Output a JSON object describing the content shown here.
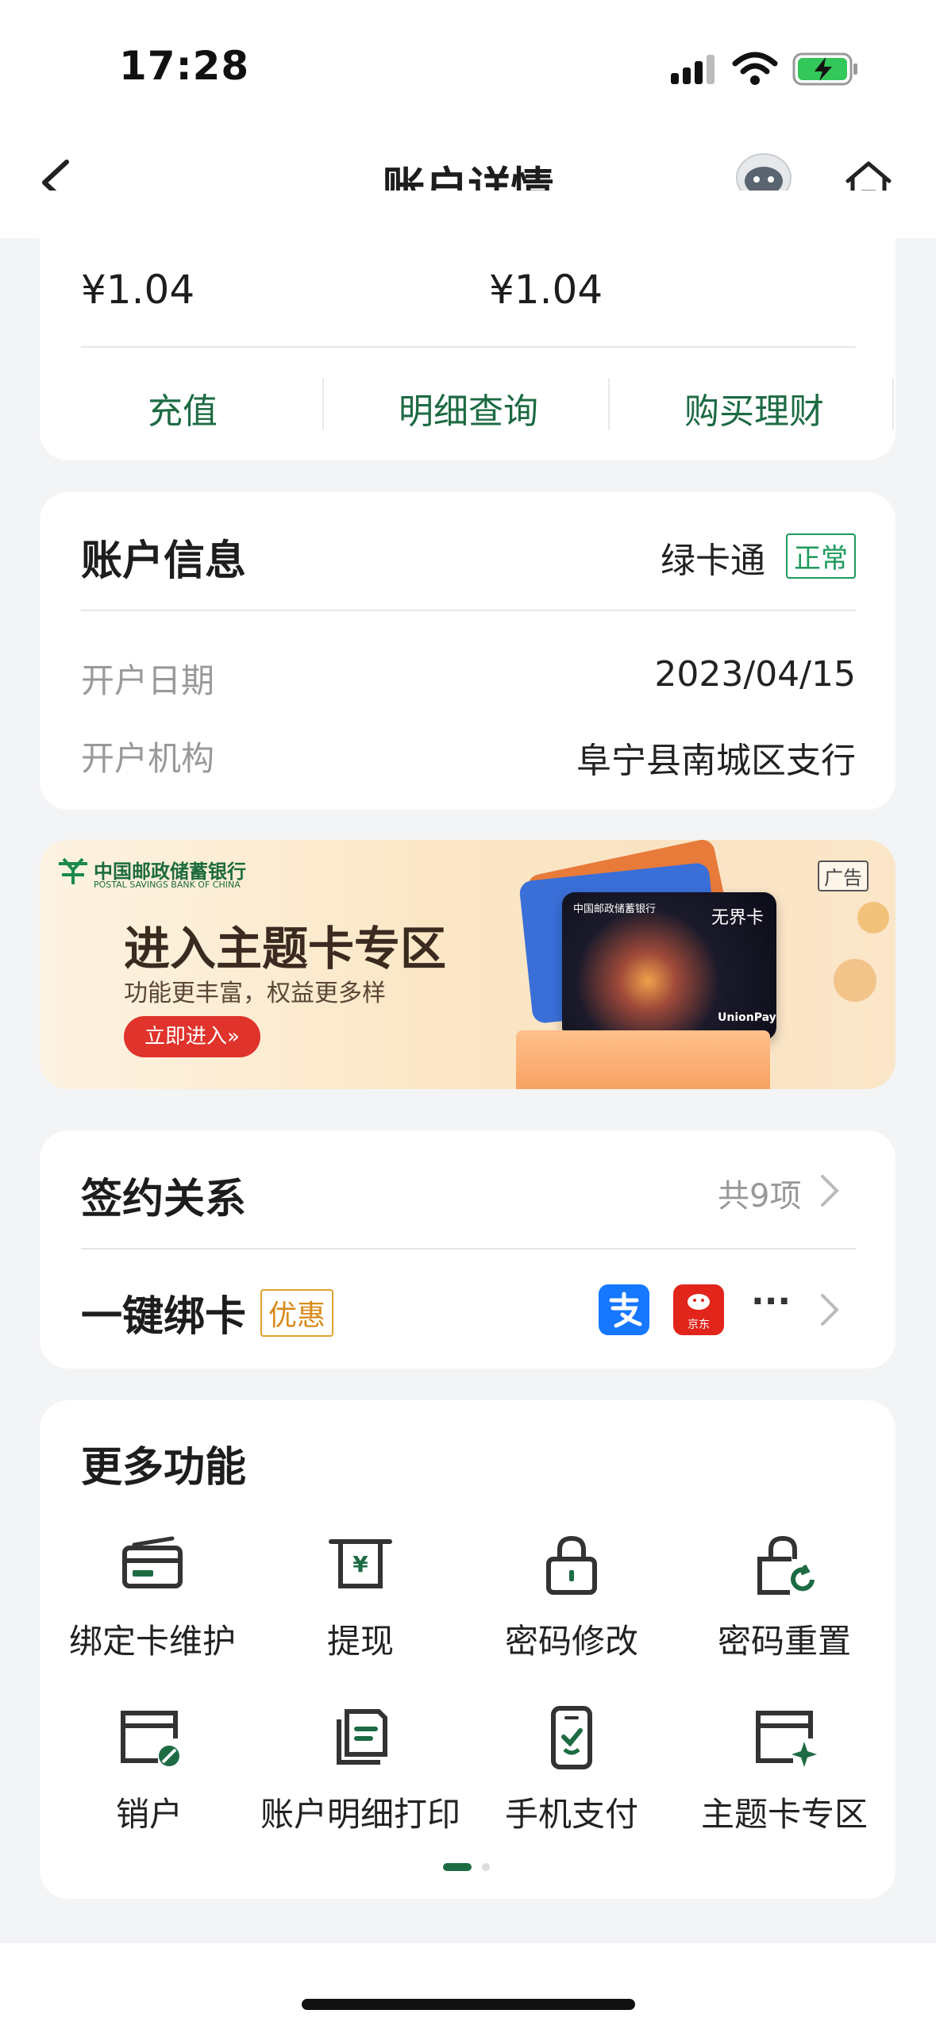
{
  "status": {
    "time": "17:28"
  },
  "nav": {
    "title": "账户详情"
  },
  "balance": {
    "amount_left": "¥1.04",
    "amount_right": "¥1.04",
    "actions": [
      "充值",
      "明细查询",
      "购买理财"
    ]
  },
  "account_info": {
    "title": "账户信息",
    "card_type": "绿卡通",
    "status": "正常",
    "rows": [
      {
        "label": "开户日期",
        "value": "2023/04/15"
      },
      {
        "label": "开户机构",
        "value": "阜宁县南城区支行"
      }
    ]
  },
  "banner": {
    "bank_name_cn": "中国邮政储蓄银行",
    "bank_name_en": "POSTAL SAVINGS BANK OF CHINA",
    "headline": "进入主题卡专区",
    "subline": "功能更丰富，权益更多样",
    "cta": "立即进入»",
    "ad_tag": "广告",
    "card_label": "无界卡",
    "card_bank": "中国邮政储蓄银行",
    "card_brand": "UnionPay"
  },
  "signing": {
    "title": "签约关系",
    "count": "共9项",
    "bind_title": "一键绑卡",
    "bind_badge": "优惠",
    "jd_label": "京东",
    "more": "···"
  },
  "more_functions": {
    "title": "更多功能",
    "items": [
      {
        "label": "绑定卡维护",
        "icon": "card-icon"
      },
      {
        "label": "提现",
        "icon": "withdraw-icon"
      },
      {
        "label": "密码修改",
        "icon": "lock-icon"
      },
      {
        "label": "密码重置",
        "icon": "lock-reset-icon"
      },
      {
        "label": "销户",
        "icon": "close-account-icon"
      },
      {
        "label": "账户明细打印",
        "icon": "print-icon"
      },
      {
        "label": "手机支付",
        "icon": "mobile-pay-icon"
      },
      {
        "label": "主题卡专区",
        "icon": "theme-card-icon"
      }
    ]
  },
  "colors": {
    "accent": "#1d6b43",
    "green_badge": "#1e9a5c",
    "orange_badge": "#d98b1b"
  }
}
